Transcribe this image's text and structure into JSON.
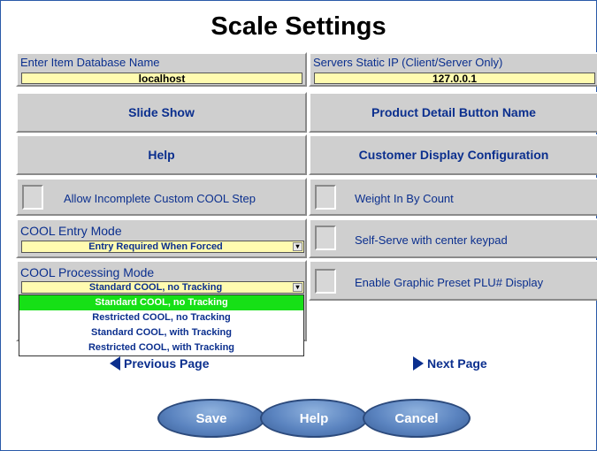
{
  "title": "Scale Settings",
  "db_field": {
    "label": "Enter Item Database Name",
    "value": "localhost"
  },
  "ip_field": {
    "label": "Servers Static IP (Client/Server Only)",
    "value": "127.0.0.1"
  },
  "buttons": {
    "slide_show": "Slide Show",
    "product_detail": "Product Detail Button Name",
    "help": "Help",
    "customer_display": "Customer Display Configuration"
  },
  "checkboxes": {
    "allow_incomplete_cool": "Allow Incomplete Custom COOL Step",
    "weight_in_by_count": "Weight In By Count",
    "self_serve": "Self-Serve with center keypad",
    "graphic_preset": "Enable Graphic Preset PLU# Display"
  },
  "cool_entry": {
    "label": "COOL Entry Mode",
    "value": "Entry Required When Forced"
  },
  "cool_processing": {
    "label": "COOL Processing Mode",
    "value": "Standard COOL, no Tracking",
    "options": [
      "Standard COOL, no Tracking",
      "Restricted COOL, no Tracking",
      "Standard COOL, with Tracking",
      "Restricted COOL, with Tracking"
    ]
  },
  "nav": {
    "previous": "Previous Page",
    "next": "Next Page"
  },
  "footer": {
    "save": "Save",
    "help": "Help",
    "cancel": "Cancel"
  },
  "colors": {
    "label_blue": "#0b2f8e",
    "field_yellow": "#fffbb0",
    "highlight_green": "#16e016",
    "button_blue": "#5b84c0"
  }
}
